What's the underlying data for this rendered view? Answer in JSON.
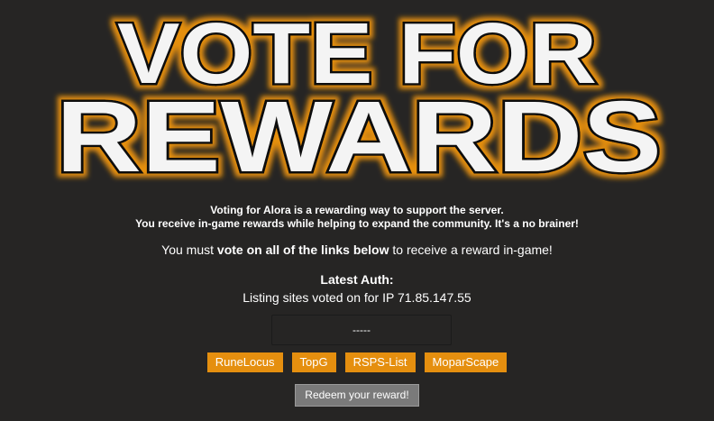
{
  "banner": {
    "line1": "VOTE FOR",
    "line2": "REWARDS",
    "glow_color": "#e58f0f",
    "fill_color": "#f4f4f4"
  },
  "intro": {
    "line1": "Voting for Alora is a rewarding way to support the server.",
    "line2": "You receive in-game rewards while helping to expand the community. It's a no brainer!"
  },
  "notice": {
    "prefix": "You must ",
    "emphasis": "vote on all of the links below",
    "suffix": " to receive a reward in-game!"
  },
  "auth": {
    "heading": "Latest Auth:",
    "subtitle": "Listing sites voted on for IP 71.85.147.55",
    "status_value": "-----"
  },
  "vote_sites": [
    {
      "label": "RuneLocus"
    },
    {
      "label": "TopG"
    },
    {
      "label": "RSPS-List"
    },
    {
      "label": "MoparScape"
    }
  ],
  "redeem": {
    "label": "Redeem your reward!"
  },
  "colors": {
    "background": "#262524",
    "vote_button": "#e58f0f",
    "redeem_button": "#7a7a7a"
  }
}
